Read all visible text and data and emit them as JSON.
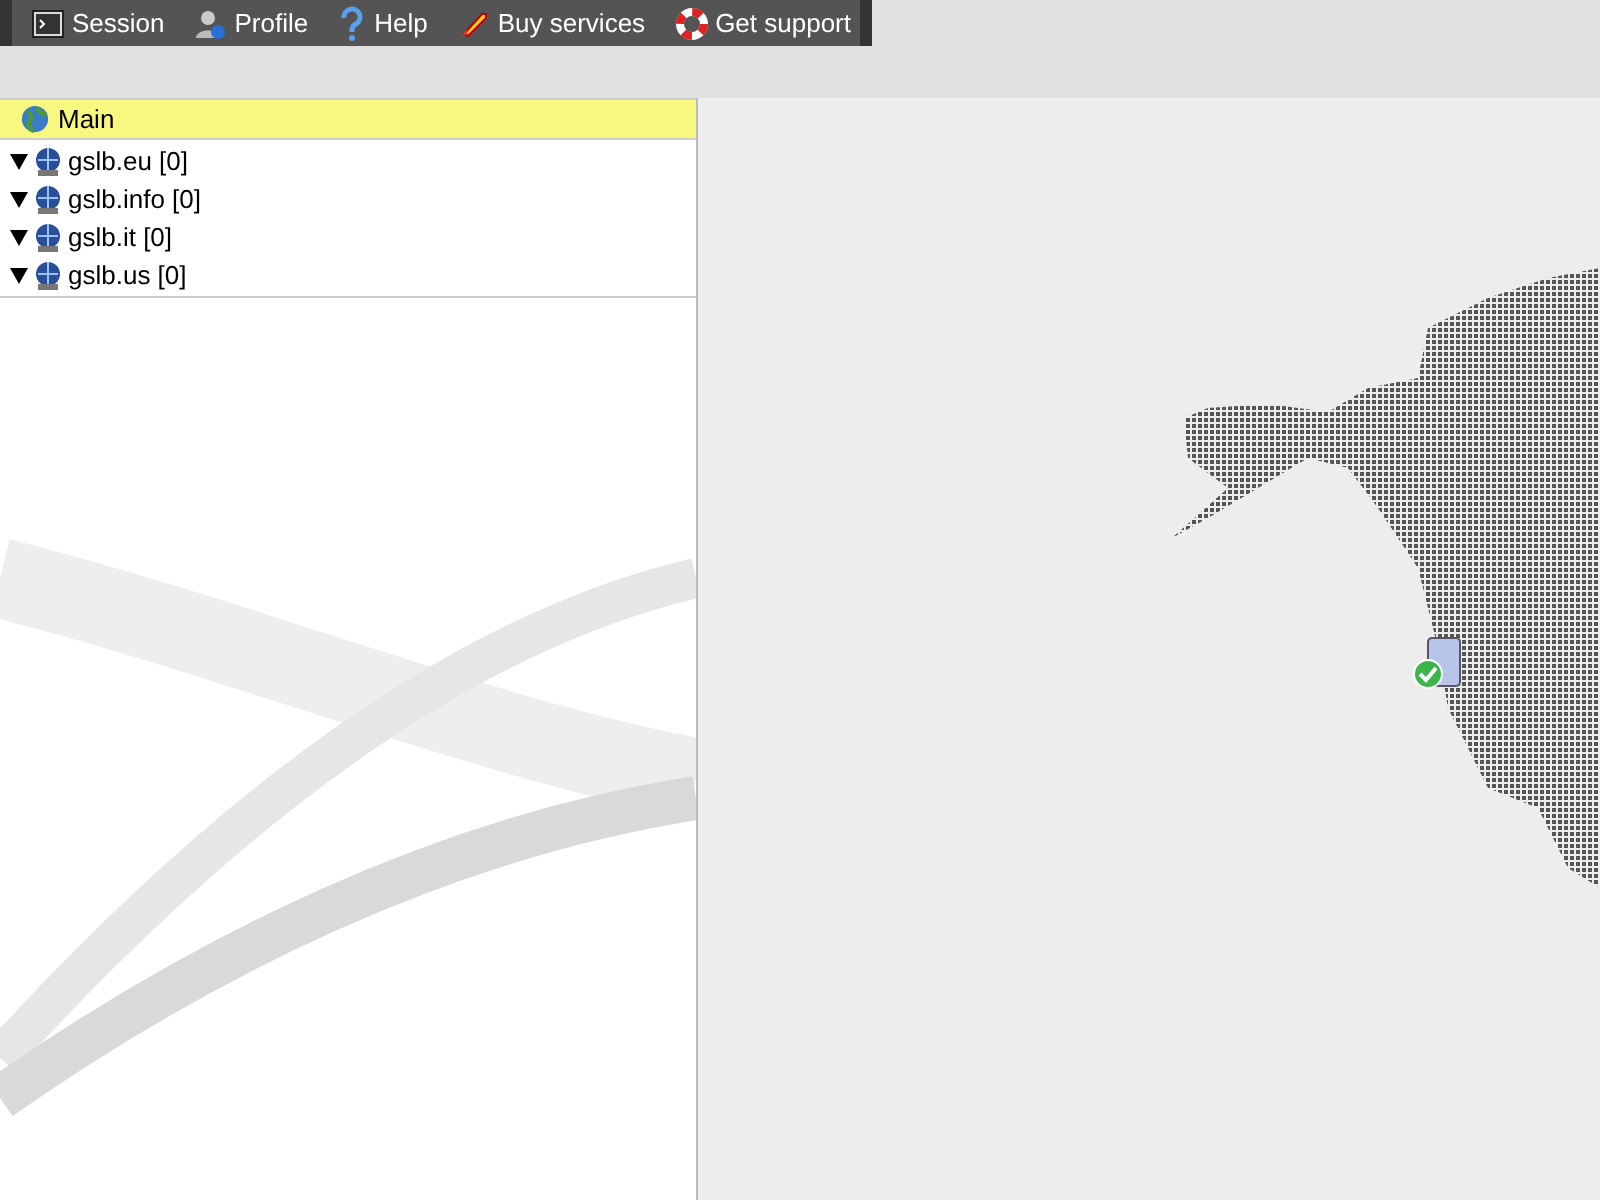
{
  "toolbar": [
    {
      "kind": "session",
      "label": "Session"
    },
    {
      "kind": "profile",
      "label": "Profile"
    },
    {
      "kind": "help",
      "label": "Help"
    },
    {
      "kind": "buy",
      "label": "Buy services"
    },
    {
      "kind": "support",
      "label": "Get support"
    }
  ],
  "tree": {
    "root": {
      "label": "Main"
    },
    "items": [
      {
        "label": "gslb.eu [0]",
        "expanded": true
      },
      {
        "label": "gslb.info [0]",
        "expanded": true
      },
      {
        "label": "gslb.it [0]",
        "expanded": true
      },
      {
        "label": "gslb.us [0]",
        "expanded": true
      }
    ]
  }
}
